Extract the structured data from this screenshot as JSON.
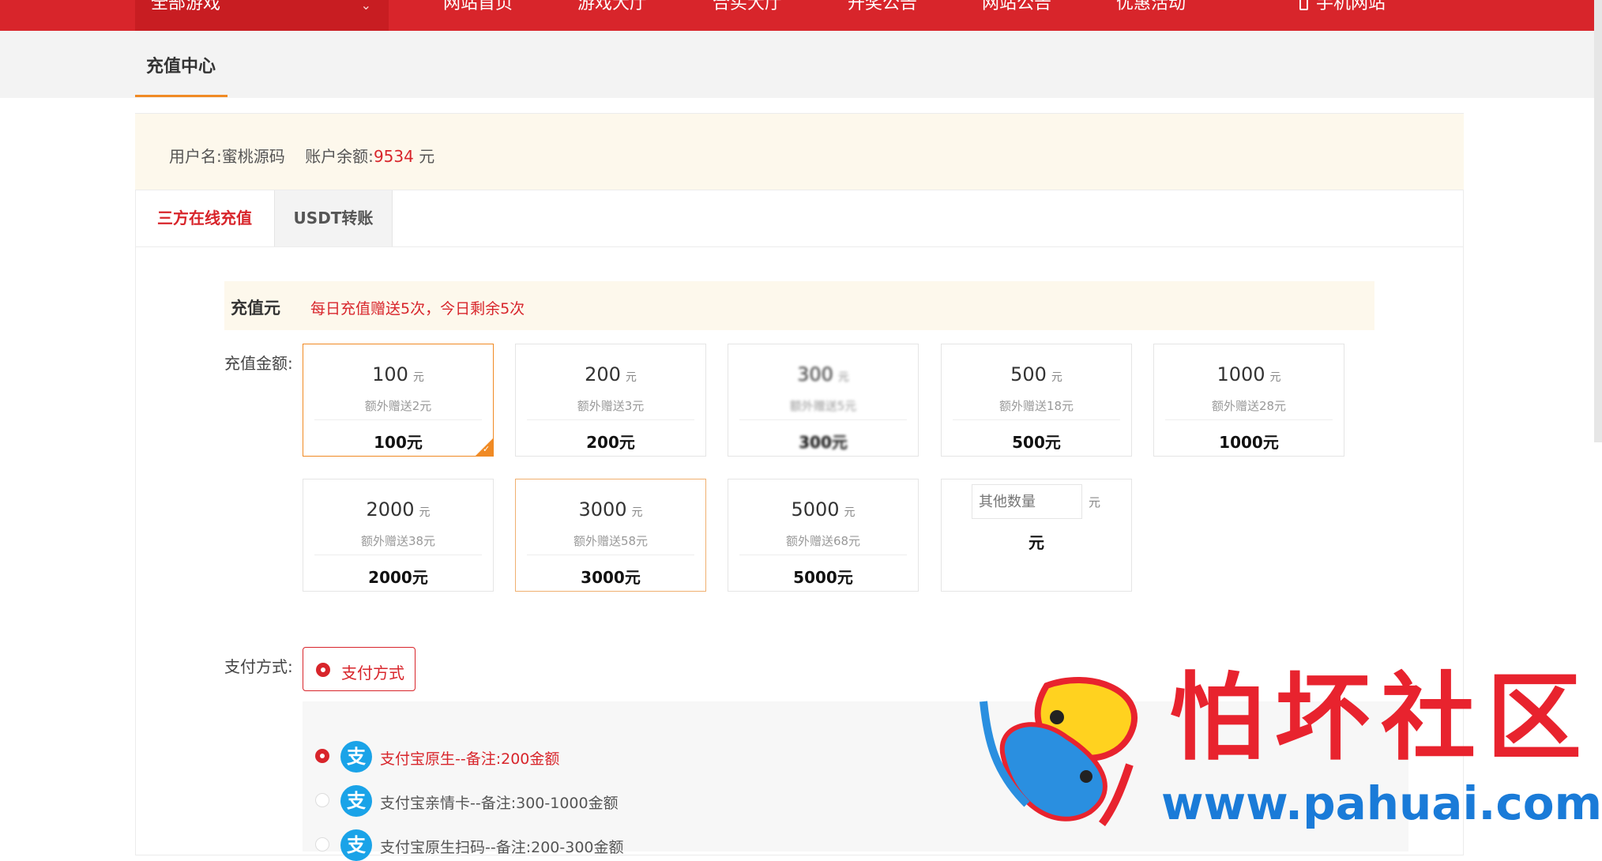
{
  "nav": {
    "all_games": "全部游戏",
    "items": [
      "网站首页",
      "游戏大厅",
      "合买大厅",
      "开奖公告",
      "网站公告",
      "优惠活动"
    ],
    "mobile": "手机网站"
  },
  "page_title": "充值中心",
  "user": {
    "username_label": "用户名:",
    "username": "蜜桃源码",
    "balance_label": "账户余额:",
    "balance": "9534",
    "balance_unit": "元"
  },
  "tabs": [
    "三方在线充值",
    "USDT转账"
  ],
  "recharge": {
    "title": "充值元",
    "notice": "每日充值赠送5次，今日剩余5次"
  },
  "amount_label": "充值金额:",
  "amounts": [
    {
      "amount": "100",
      "unit": "元",
      "bonus": "额外赠送2元",
      "total": "100元"
    },
    {
      "amount": "200",
      "unit": "元",
      "bonus": "额外赠送3元",
      "total": "200元"
    },
    {
      "amount": "300",
      "unit": "元",
      "bonus": "额外赠送5元",
      "total": "300元"
    },
    {
      "amount": "500",
      "unit": "元",
      "bonus": "额外赠送18元",
      "total": "500元"
    },
    {
      "amount": "1000",
      "unit": "元",
      "bonus": "额外赠送28元",
      "total": "1000元"
    },
    {
      "amount": "2000",
      "unit": "元",
      "bonus": "额外赠送38元",
      "total": "2000元"
    },
    {
      "amount": "3000",
      "unit": "元",
      "bonus": "额外赠送58元",
      "total": "3000元"
    },
    {
      "amount": "5000",
      "unit": "元",
      "bonus": "额外赠送68元",
      "total": "5000元"
    }
  ],
  "other": {
    "placeholder": "其他数量",
    "unit": "元",
    "total": "元"
  },
  "payment_label": "支付方式:",
  "payment_button": "支付方式",
  "payment_options": [
    {
      "icon": "alipay-icon",
      "glyph": "支",
      "label": "支付宝原生--备注:200金额"
    },
    {
      "icon": "alipay-icon",
      "glyph": "支",
      "label": "支付宝亲情卡--备注:300-1000金额"
    },
    {
      "icon": "alipay-icon",
      "glyph": "支",
      "label": "支付宝原生扫码--备注:200-300金额"
    }
  ],
  "watermark": {
    "title": "怕坏社区",
    "url": "www.pahuai.com"
  },
  "colors": {
    "brand_red": "#d8252b",
    "accent_orange": "#f08a24",
    "alipay_blue": "#1aa3e8"
  }
}
